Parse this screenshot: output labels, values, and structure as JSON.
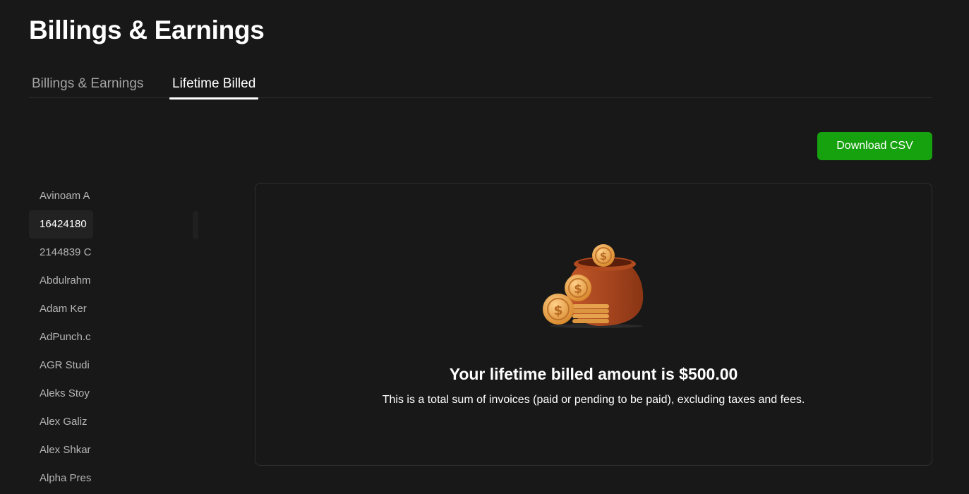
{
  "page": {
    "title": "Billings & Earnings"
  },
  "tabs": [
    {
      "label": "Billings & Earnings"
    },
    {
      "label": "Lifetime Billed"
    }
  ],
  "actions": {
    "download_label": "Download CSV"
  },
  "clients": [
    "Avinoam A",
    "16424180 ",
    "2144839 C",
    "Abdulrahm",
    "Adam Ker",
    "AdPunch.c",
    "AGR Studi",
    "Aleks Stoy",
    "Alex Galiz",
    "Alex Shkar",
    "Alpha Pres"
  ],
  "summary": {
    "headline": "Your lifetime billed amount is $500.00",
    "description": "This is a total sum of invoices (paid or pending to be paid), excluding taxes and fees.",
    "illustration_icon": "money-pot-icon"
  },
  "colors": {
    "accent_green": "#16a10f",
    "background": "#181818",
    "pot": "#a8451c",
    "coin": "#e8a24c"
  }
}
